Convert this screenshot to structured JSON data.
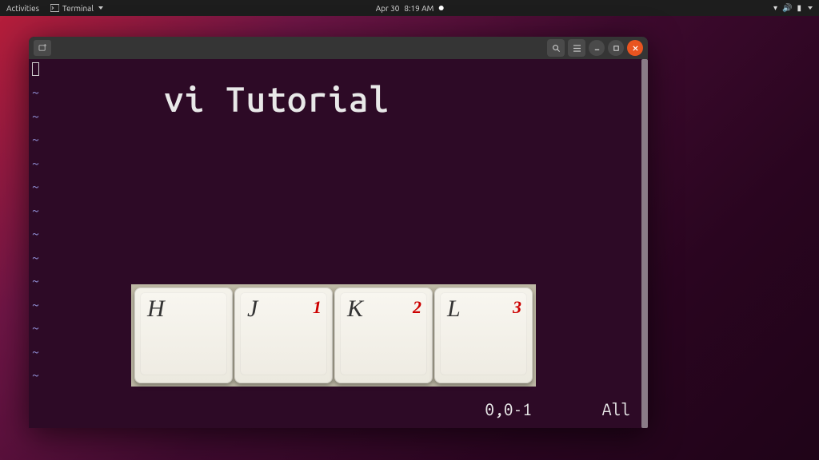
{
  "topbar": {
    "activities": "Activities",
    "app_name": "Terminal",
    "date": "Apr 30",
    "time": "8:19 AM"
  },
  "window": {
    "controls": {
      "search": "⌕",
      "menu": "≡",
      "minimize": "—",
      "maximize": "▢",
      "close": "✕"
    }
  },
  "editor": {
    "title_overlay": "vi Tutorial",
    "tilde": "~",
    "status_position": "0,0-1",
    "status_view": "All"
  },
  "keys": [
    {
      "letter": "H",
      "num": ""
    },
    {
      "letter": "J",
      "num": "1"
    },
    {
      "letter": "K",
      "num": "2"
    },
    {
      "letter": "L",
      "num": "3"
    }
  ]
}
